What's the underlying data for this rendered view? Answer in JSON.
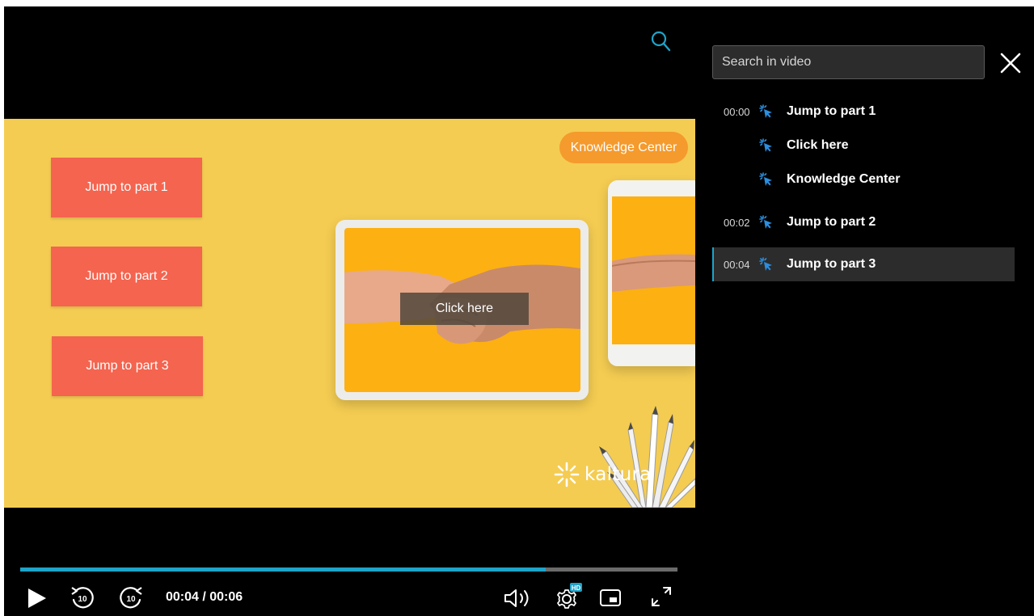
{
  "panel": {
    "search_placeholder": "Search in video",
    "cues": [
      {
        "time": "00:00",
        "label": "Jump to part 1",
        "active": false
      },
      {
        "time": "",
        "label": "Click here",
        "active": false
      },
      {
        "time": "",
        "label": "Knowledge Center",
        "active": false
      },
      {
        "time": "00:02",
        "label": "Jump to part 2",
        "active": false
      },
      {
        "time": "00:04",
        "label": "Jump to part 3",
        "active": true
      }
    ]
  },
  "video": {
    "buttons": [
      "Jump to part 1",
      "Jump to part 2",
      "Jump to part 3"
    ],
    "knowledge_center": "Knowledge Center",
    "click_here": "Click here",
    "logo_text": "kaltura"
  },
  "controls": {
    "time": "00:04 / 00:06",
    "progress": 0.8,
    "settings_badge": "HD"
  },
  "colors": {
    "accent": "#1ea4c9",
    "video_bg": "#f4cc52",
    "button_bg": "#f4644f",
    "pill_bg": "#f59a2c",
    "cue_icon": "#2b8fe0"
  },
  "icons": [
    "search-icon",
    "close-icon",
    "play-icon",
    "rewind-10-icon",
    "forward-10-icon",
    "volume-icon",
    "settings-icon",
    "pip-icon",
    "fullscreen-icon",
    "hotspot-icon",
    "kaltura-logo-icon"
  ]
}
